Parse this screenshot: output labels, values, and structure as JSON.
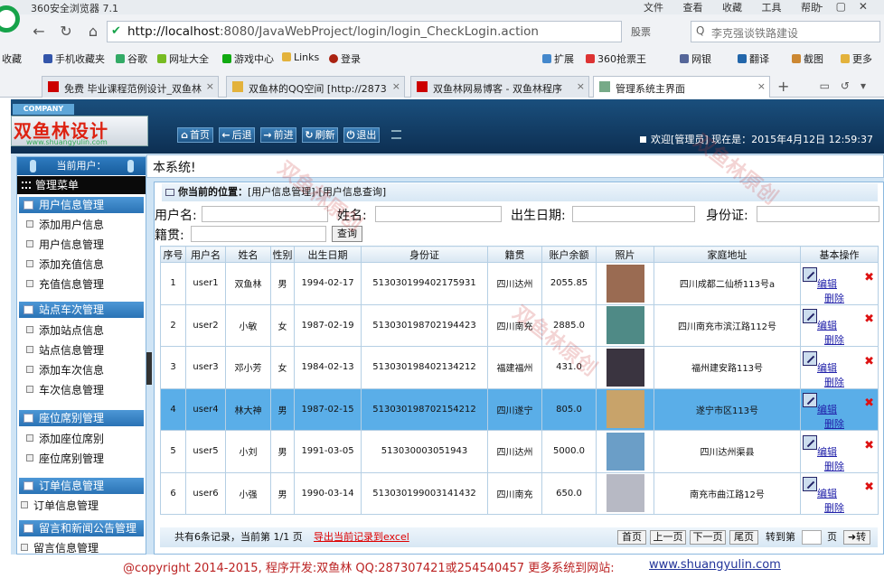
{
  "browser": {
    "title": "360安全浏览器 7.1",
    "menus": [
      "文件",
      "查看",
      "收藏",
      "工具",
      "帮助"
    ],
    "url_host": "http://localhost",
    "url_path": ":8080/JavaWebProject/login/login_CheckLogin.action",
    "ext_label": "股票",
    "search_placeholder": "李克强谈铁路建设",
    "bookmarks": [
      "收藏",
      "手机收藏夹",
      "谷歌",
      "网址大全",
      "游戏中心",
      "Links",
      "登录",
      "扩展",
      "360抢票王",
      "网银",
      "翻译",
      "截图",
      "更多"
    ],
    "tabs": [
      {
        "label": "免费 毕业课程范例设计_双鱼林"
      },
      {
        "label": "双鱼林的QQ空间 [http://2873"
      },
      {
        "label": "双鱼林网易博客 - 双鱼林程序"
      },
      {
        "label": "管理系统主界面"
      }
    ]
  },
  "app": {
    "company": "COMPANY",
    "logo_text": "双鱼林设计",
    "logo_url": "www.shuangyulin.com",
    "nav": [
      "首页",
      "后退",
      "前进",
      "刷新",
      "退出"
    ],
    "welcome": "欢迎[管理员]   现在是：2015年4月12日 12:59:37",
    "subtitle": "本系统!",
    "current_user": "当前用户：",
    "menu_title": "管理菜单",
    "groups": [
      {
        "title": "用户信息管理",
        "items": [
          "添加用户信息",
          "用户信息管理",
          "添加充值信息",
          "充值信息管理"
        ]
      },
      {
        "title": "站点车次管理",
        "items": [
          "添加站点信息",
          "站点信息管理",
          "添加车次信息",
          "车次信息管理"
        ]
      },
      {
        "title": "座位席别管理",
        "items": [
          "添加座位席别",
          "座位席别管理"
        ]
      },
      {
        "title": "订单信息管理",
        "items": [
          "订单信息管理"
        ]
      },
      {
        "title": "留言和新闻公告管理",
        "items": [
          "留言信息管理"
        ]
      }
    ],
    "position": "你当前的位置：",
    "position_path": "[用户信息管理]-[用户信息查询]",
    "form": {
      "username": "用户名:",
      "name": "姓名:",
      "birthday": "出生日期:",
      "idcard": "身份证:",
      "hometown": "籍贯:",
      "query": "查询"
    },
    "table": {
      "headers": [
        "序号",
        "用户名",
        "姓名",
        "性别",
        "出生日期",
        "身份证",
        "籍贯",
        "账户余额",
        "照片",
        "家庭地址",
        "基本操作"
      ],
      "edit": "编辑",
      "delete": "删除",
      "rows": [
        {
          "no": "1",
          "user": "user1",
          "name": "双鱼林",
          "sex": "男",
          "birth": "1994-02-17",
          "id": "513030199402175931",
          "town": "四川达州",
          "bal": "2055.85",
          "addr": "四川成都二仙桥113号a",
          "photo": "#9a6b52"
        },
        {
          "no": "2",
          "user": "user2",
          "name": "小敏",
          "sex": "女",
          "birth": "1987-02-19",
          "id": "513030198702194423",
          "town": "四川南充",
          "bal": "2885.0",
          "addr": "四川南充市滨江路112号",
          "photo": "#4f8a86"
        },
        {
          "no": "3",
          "user": "user3",
          "name": "邓小芳",
          "sex": "女",
          "birth": "1984-02-13",
          "id": "513030198402134212",
          "town": "福建福州",
          "bal": "431.0",
          "addr": "福州建安路113号",
          "photo": "#3a3440"
        },
        {
          "no": "4",
          "user": "user4",
          "name": "林大神",
          "sex": "男",
          "birth": "1987-02-15",
          "id": "513030198702154212",
          "town": "四川遂宁",
          "bal": "805.0",
          "addr": "遂宁市区113号",
          "photo": "#c8a36a"
        },
        {
          "no": "5",
          "user": "user5",
          "name": "小刘",
          "sex": "男",
          "birth": "1991-03-05",
          "id": "513030003051943",
          "town": "四川达州",
          "bal": "5000.0",
          "addr": "四川达州渠县",
          "photo": "#6b9ec7"
        },
        {
          "no": "6",
          "user": "user6",
          "name": "小强",
          "sex": "男",
          "birth": "1990-03-14",
          "id": "513030199003141432",
          "town": "四川南充",
          "bal": "650.0",
          "addr": "南充市曲江路12号",
          "photo": "#b7b9c4"
        }
      ]
    },
    "footer": {
      "count": "共有6条记录，当前第 1/1 页",
      "export": "导出当前记录到excel",
      "first": "首页",
      "prev": "上一页",
      "next": "下一页",
      "last": "尾页",
      "goto": "转到第",
      "page": "页",
      "go": "转"
    }
  },
  "copyright": {
    "text": "@copyright 2014-2015, 程序开发:双鱼林  QQ:287307421或254540457   更多系统到网站:",
    "site": "www.shuangyulin.com"
  }
}
